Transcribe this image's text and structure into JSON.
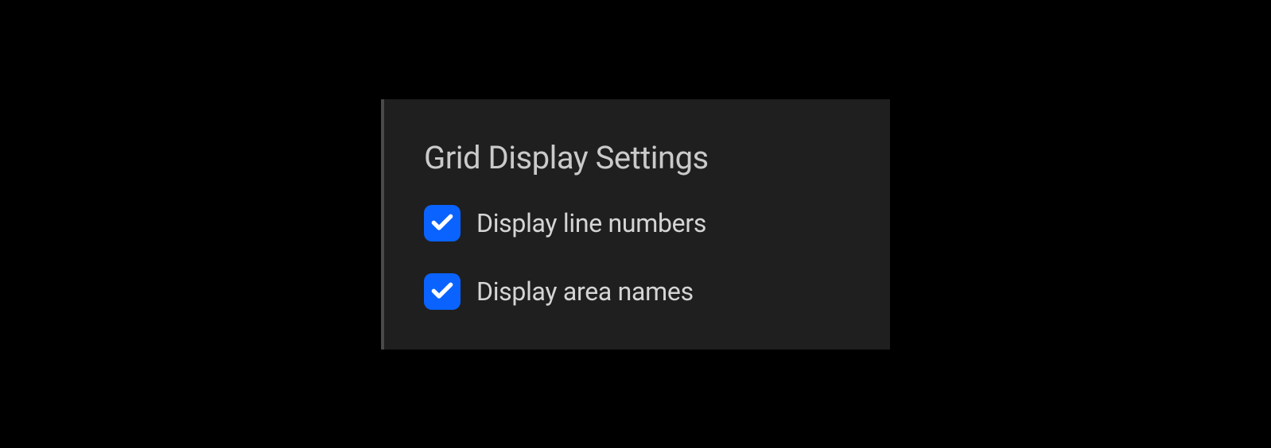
{
  "panel": {
    "title": "Grid Display Settings",
    "options": [
      {
        "label": "Display line numbers",
        "checked": true
      },
      {
        "label": "Display area names",
        "checked": true
      }
    ]
  },
  "colors": {
    "checkbox_bg": "#0a63ff",
    "panel_bg": "#1f1f1f",
    "text": "#d5d5d5"
  }
}
